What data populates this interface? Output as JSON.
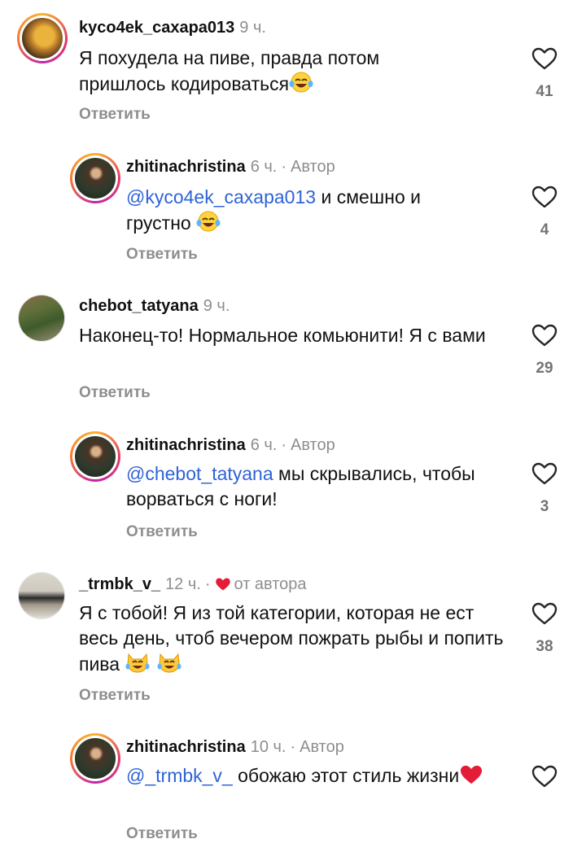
{
  "colors": {
    "mention": "#2f63d6",
    "muted": "#8e8e8e",
    "heart": "#e41c37"
  },
  "comments": [
    {
      "username": "kyco4ek_caxapa013",
      "time": "9 ч.",
      "text": "Я похудела на пиве, правда потом пришлось кодироваться",
      "emoji": "laughing-tears",
      "reply": "Ответить",
      "likes": "41"
    },
    {
      "username": "zhitinachristina",
      "time": "6 ч.",
      "tag": "Автор",
      "mention": "@kyco4ek_caxapa013",
      "text": " и смешно и грустно ",
      "emoji": "laughing-tears",
      "reply": "Ответить",
      "likes": "4"
    },
    {
      "username": "chebot_tatyana",
      "time": "9 ч.",
      "text": "Наконец-то! Нормальное комьюнити! Я с вами",
      "reply": "Ответить",
      "likes": "29"
    },
    {
      "username": "zhitinachristina",
      "time": "6 ч.",
      "tag": "Автор",
      "mention": "@chebot_tatyana",
      "text": " мы скрывались, чтобы ворваться с ноги!",
      "reply": "Ответить",
      "likes": "3"
    },
    {
      "username": "_trmbk_v_",
      "time": "12 ч.",
      "tag": "от автора",
      "text": "Я с тобой! Я из той категории, которая не ест весь день, чтоб вечером пожрать рыбы и попить пива ",
      "emoji": "crying-laughing-cats",
      "reply": "Ответить",
      "likes": "38"
    },
    {
      "username": "zhitinachristina",
      "time": "10 ч.",
      "tag": "Автор",
      "mention": "@_trmbk_v_",
      "text": " обожаю этот стиль жизни",
      "emoji": "red-heart",
      "reply": "Ответить"
    }
  ]
}
